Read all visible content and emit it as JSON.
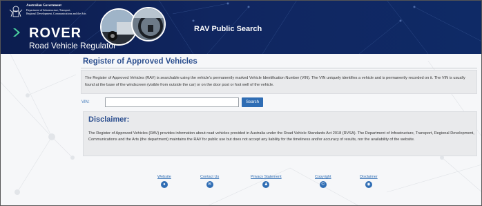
{
  "header": {
    "gov_line1": "Australian Government",
    "gov_line2": "Department of Infrastructure, Transport,",
    "gov_line3": "Regional Development, Communications and the Arts",
    "logo_title": "ROVER",
    "logo_subtitle": "Road Vehicle Regulator",
    "page_heading": "RAV Public Search"
  },
  "main": {
    "title": "Register of Approved Vehicles",
    "intro": "The Register of Approved Vehicles (RAV) is searchable using the vehicle's permanently marked Vehicle Identification Number (VIN). The VIN uniquely identifies a vehicle and is permanently recorded on it. The VIN is usually found at the base of the windscreen (visible from outside the car) or on the door post or foot well of the vehicle.",
    "vin_label": "VIN:",
    "vin_value": "",
    "search_label": "Search",
    "disclaimer_title": "Disclaimer:",
    "disclaimer_text": "The Register of Approved Vehicles (RAV) provides information about road vehicles provided in Australia under the Road Vehicle Standards Act 2018 (RVSA). The Department of Infrastructure, Transport, Regional Development, Communications and the Arts (the department) maintains the RAV for public use but does not accept any liability for the timeliness and/or accuracy of results, nor the availability of the website."
  },
  "footer": {
    "links": [
      {
        "label": "Website",
        "icon": "globe-icon"
      },
      {
        "label": "Contact Us",
        "icon": "mail-icon"
      },
      {
        "label": "Privacy Statement",
        "icon": "person-icon"
      },
      {
        "label": "Copyright",
        "icon": "copyright-icon"
      },
      {
        "label": "Disclaimer",
        "icon": "info-icon"
      }
    ]
  },
  "colors": {
    "header_navy": "#0f2a66",
    "accent_blue": "#2f6db4",
    "title_blue": "#2c4f8f",
    "logo_green": "#4cd3a0",
    "panel_grey": "#e9eaec"
  }
}
